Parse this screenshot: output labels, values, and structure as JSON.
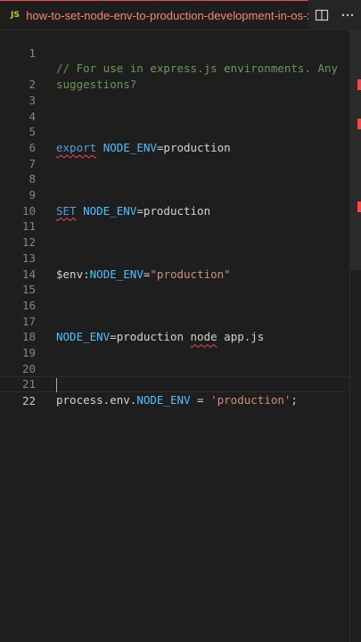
{
  "tab": {
    "lang_badge": "JS",
    "title": "how-to-set-node-env-to-production-development-in-os-x.js"
  },
  "actions": {
    "split_icon": "split-editor-icon",
    "more_icon": "more-actions-icon",
    "more_label": "···"
  },
  "editor": {
    "lines": [
      {
        "n": "1",
        "text": "// For use in express.js environments. Any"
      },
      {
        "n": "",
        "text": "suggestions?"
      },
      {
        "n": "2",
        "text": ""
      },
      {
        "n": "3",
        "text": ""
      },
      {
        "n": "4",
        "text": ""
      },
      {
        "n": "5",
        "text": "export NODE_ENV=production"
      },
      {
        "n": "6",
        "text": ""
      },
      {
        "n": "7",
        "text": ""
      },
      {
        "n": "8",
        "text": ""
      },
      {
        "n": "9",
        "text": "SET NODE_ENV=production"
      },
      {
        "n": "10",
        "text": ""
      },
      {
        "n": "11",
        "text": ""
      },
      {
        "n": "12",
        "text": ""
      },
      {
        "n": "13",
        "text": "$env:NODE_ENV=\"production\""
      },
      {
        "n": "14",
        "text": ""
      },
      {
        "n": "15",
        "text": ""
      },
      {
        "n": "16",
        "text": ""
      },
      {
        "n": "17",
        "text": "NODE_ENV=production node app.js"
      },
      {
        "n": "18",
        "text": ""
      },
      {
        "n": "19",
        "text": ""
      },
      {
        "n": "20",
        "text": ""
      },
      {
        "n": "21",
        "text": "process.env.NODE_ENV = 'production';"
      },
      {
        "n": "22",
        "text": ""
      }
    ],
    "current_line": "22"
  },
  "colors": {
    "background": "#1e1e1e",
    "comment": "#6a9955",
    "keyword": "#569cd6",
    "string": "#ce9178",
    "error": "#f14c4c",
    "tab_title": "#f48771"
  }
}
